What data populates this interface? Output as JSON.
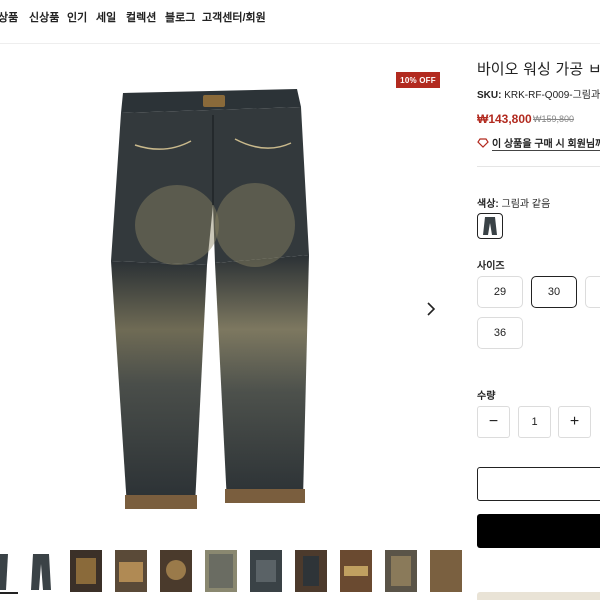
{
  "nav": {
    "items": [
      "상품",
      "신상품",
      "인기",
      "세일",
      "컬렉션",
      "블로그",
      "고객센터/회원"
    ]
  },
  "gallery": {
    "badge": "10% OFF",
    "main_image": "jeans-front",
    "next_icon": "chevron-right-icon",
    "thumbnails": [
      {
        "name": "jeans-side"
      },
      {
        "name": "jeans-front"
      },
      {
        "name": "jeans-detail-1"
      },
      {
        "name": "jeans-detail-2"
      },
      {
        "name": "jeans-detail-3"
      },
      {
        "name": "jeans-detail-4"
      },
      {
        "name": "jeans-detail-5"
      },
      {
        "name": "jeans-detail-6"
      },
      {
        "name": "jeans-detail-7"
      },
      {
        "name": "jeans-detail-8"
      }
    ]
  },
  "product": {
    "title": "바이오 워싱 가공 ㅂ",
    "sku_label": "SKU:",
    "sku_value": "KRK-RF-Q009-그림과 같",
    "price": "₩143,800",
    "original_price": "₩159,800",
    "points_text": "이 상품을 구매 시 회원님께",
    "color_label": "색상:",
    "color_value": "그림과 같음",
    "size_label": "사이즈",
    "sizes": [
      "29",
      "30",
      "36"
    ],
    "selected_size": "30",
    "qty_label": "수량",
    "qty_value": "1",
    "minus": "−",
    "plus": "+"
  },
  "colors": {
    "accent": "#b22a1f",
    "text": "#222222",
    "border": "#dcdcdc",
    "denim_dark": "#2e3438",
    "denim_fade": "#8c8463"
  }
}
